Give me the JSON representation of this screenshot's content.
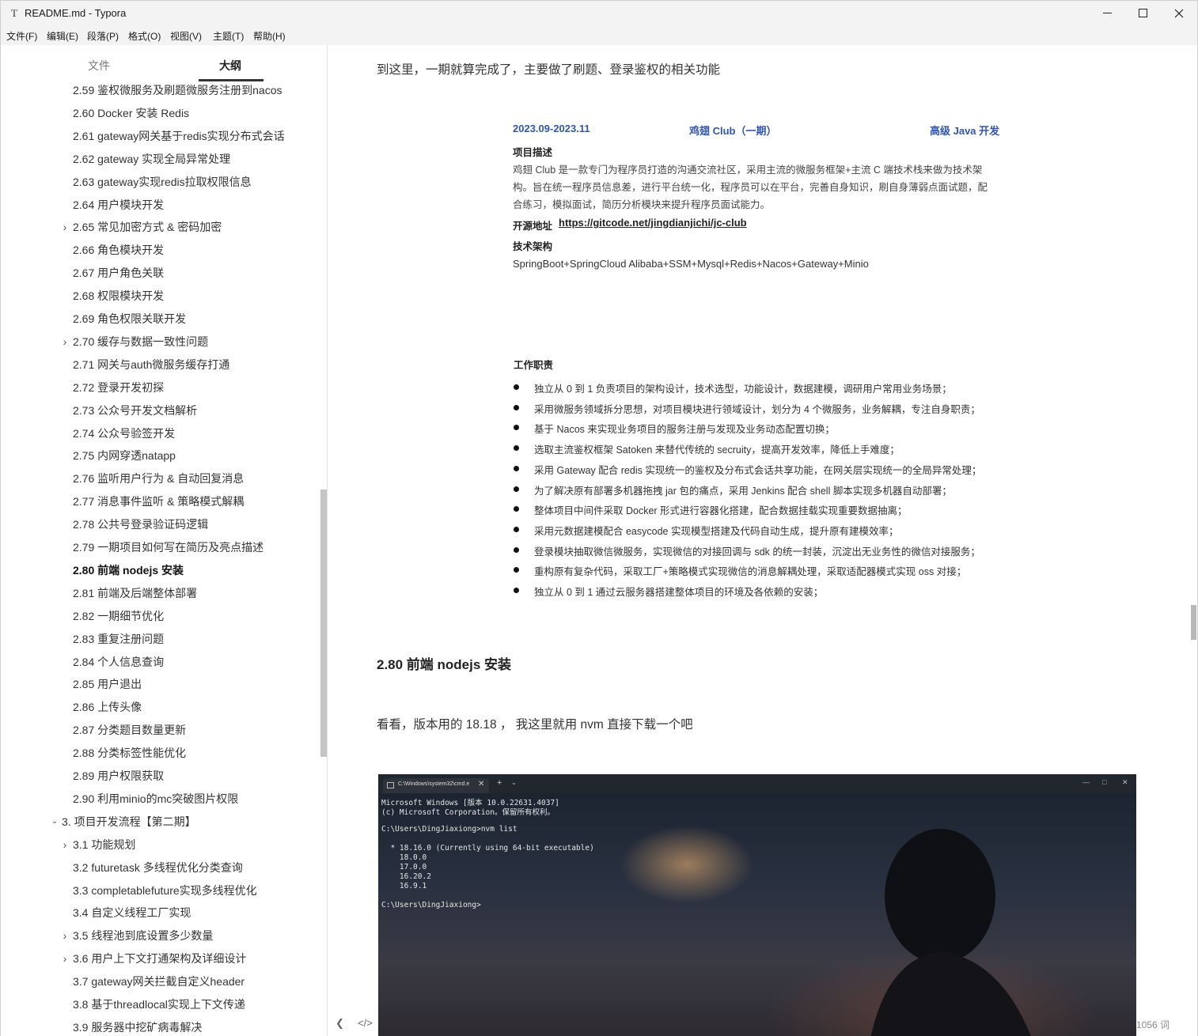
{
  "window": {
    "app_icon": "T",
    "title": "README.md - Typora",
    "controls": [
      "minimize-icon",
      "maximize-icon",
      "close-icon"
    ]
  },
  "menu": [
    "文件(F)",
    "编辑(E)",
    "段落(P)",
    "格式(O)",
    "视图(V)",
    "主题(T)",
    "帮助(H)"
  ],
  "sidebar": {
    "tabs": [
      "文件",
      "大纲"
    ],
    "active_tab": "大纲",
    "items": [
      {
        "label": "2.59 鉴权微服务及刷题微服务注册到nacos",
        "chevron": false,
        "active": false
      },
      {
        "label": "2.60 Docker 安装 Redis",
        "chevron": false,
        "active": false
      },
      {
        "label": "2.61 gateway网关基于redis实现分布式会话",
        "chevron": false,
        "active": false
      },
      {
        "label": "2.62 gateway 实现全局异常处理",
        "chevron": false,
        "active": false
      },
      {
        "label": "2.63 gateway实现redis拉取权限信息",
        "chevron": false,
        "active": false
      },
      {
        "label": "2.64 用户模块开发",
        "chevron": false,
        "active": false
      },
      {
        "label": "2.65 常见加密方式 & 密码加密",
        "chevron": true,
        "active": false
      },
      {
        "label": "2.66 角色模块开发",
        "chevron": false,
        "active": false
      },
      {
        "label": "2.67 用户角色关联",
        "chevron": false,
        "active": false
      },
      {
        "label": "2.68 权限模块开发",
        "chevron": false,
        "active": false
      },
      {
        "label": "2.69 角色权限关联开发",
        "chevron": false,
        "active": false
      },
      {
        "label": "2.70 缓存与数据一致性问题",
        "chevron": true,
        "active": false
      },
      {
        "label": "2.71 网关与auth微服务缓存打通",
        "chevron": false,
        "active": false
      },
      {
        "label": "2.72 登录开发初探",
        "chevron": false,
        "active": false
      },
      {
        "label": "2.73 公众号开发文档解析",
        "chevron": false,
        "active": false
      },
      {
        "label": "2.74 公众号验签开发",
        "chevron": false,
        "active": false
      },
      {
        "label": "2.75 内网穿透natapp",
        "chevron": false,
        "active": false
      },
      {
        "label": "2.76 监听用户行为 & 自动回复消息",
        "chevron": false,
        "active": false
      },
      {
        "label": "2.77 消息事件监听 & 策略模式解耦",
        "chevron": false,
        "active": false
      },
      {
        "label": "2.78 公共号登录验证码逻辑",
        "chevron": false,
        "active": false
      },
      {
        "label": "2.79 一期项目如何写在简历及亮点描述",
        "chevron": false,
        "active": false
      },
      {
        "label": "2.80 前端 nodejs 安装",
        "chevron": false,
        "active": true
      },
      {
        "label": "2.81 前端及后端整体部署",
        "chevron": false,
        "active": false
      },
      {
        "label": "2.82 一期细节优化",
        "chevron": false,
        "active": false
      },
      {
        "label": "2.83 重复注册问题",
        "chevron": false,
        "active": false
      },
      {
        "label": "2.84 个人信息查询",
        "chevron": false,
        "active": false
      },
      {
        "label": "2.85 用户退出",
        "chevron": false,
        "active": false
      },
      {
        "label": "2.86 上传头像",
        "chevron": false,
        "active": false
      },
      {
        "label": "2.87 分类题目数量更新",
        "chevron": false,
        "active": false
      },
      {
        "label": "2.88 分类标签性能优化",
        "chevron": false,
        "active": false
      },
      {
        "label": "2.89 用户权限获取",
        "chevron": false,
        "active": false
      },
      {
        "label": "2.90 利用minio的mc突破图片权限",
        "chevron": false,
        "active": false
      },
      {
        "label": "3. 项目开发流程【第二期】",
        "chevron": "down",
        "active": false,
        "level": 0
      },
      {
        "label": "3.1 功能规划",
        "chevron": true,
        "active": false
      },
      {
        "label": "3.2 futuretask 多线程优化分类查询",
        "chevron": false,
        "active": false
      },
      {
        "label": "3.3 completablefuture实现多线程优化",
        "chevron": false,
        "active": false
      },
      {
        "label": "3.4 自定义线程工厂实现",
        "chevron": false,
        "active": false
      },
      {
        "label": "3.5 线程池到底设置多少数量",
        "chevron": true,
        "active": false
      },
      {
        "label": "3.6 用户上下文打通架构及详细设计",
        "chevron": true,
        "active": false
      },
      {
        "label": "3.7 gateway网关拦截自定义header",
        "chevron": false,
        "active": false
      },
      {
        "label": "3.8 基于threadlocal实现上下文传递",
        "chevron": false,
        "active": false
      },
      {
        "label": "3.9 服务器中挖矿病毒解决",
        "chevron": false,
        "active": false
      }
    ]
  },
  "main": {
    "intro": "到这里，一期就算完成了，主要做了刷题、登录鉴权的相关功能",
    "resume": {
      "date": "2023.09-2023.11",
      "project": "鸡翅 Club（一期）",
      "role": "高级 Java 开发",
      "desc_title": "项目描述",
      "desc_lines": [
        "鸡翅 Club 是一款专门为程序员打造的沟通交流社区，采用主流的微服务框架+主流 C 端技术栈来做为技术架",
        "构。旨在统一程序员信息差，进行平台统一化，程序员可以在平台，完善自身知识，刷自身薄弱点面试题，配",
        "合练习，模拟面试，简历分析模块来提升程序员面试能力。"
      ],
      "repo_label": "开源地址",
      "repo_url": "https://gitcode.net/jingdianjichi/jc-club",
      "arch_title": "技术架构",
      "arch": "SpringBoot+SpringCloud Alibaba+SSM+Mysql+Redis+Nacos+Gateway+Minio",
      "duty_title": "工作职责",
      "duties": [
        "独立从 0 到 1 负责项目的架构设计，技术选型，功能设计，数据建模，调研用户常用业务场景；",
        "采用微服务领域拆分思想，对项目模块进行领域设计，划分为 4 个微服务，业务解耦，专注自身职责；",
        "基于 Nacos 来实现业务项目的服务注册与发现及业务动态配置切换；",
        "选取主流鉴权框架 Satoken 来替代传统的 secruity，提高开发效率，降低上手难度；",
        "采用 Gateway 配合 redis 实现统一的鉴权及分布式会话共享功能，在网关层实现统一的全局异常处理；",
        "为了解决原有部署多机器拖拽 jar 包的痛点，采用 Jenkins 配合 shell 脚本实现多机器自动部署；",
        "整体项目中间件采取 Docker 形式进行容器化搭建，配合数据挂载实现重要数据抽离；",
        "采用元数据建模配合 easycode 实现模型搭建及代码自动生成，提升原有建模效率；",
        "登录模块抽取微信微服务，实现微信的对接回调与 sdk 的统一封装，沉淀出无业务性的微信对接服务；",
        "重构原有复杂代码，采取工厂+策略模式实现微信的消息解耦处理，采取适配器模式实现 oss 对接；",
        "独立从 0 到 1 通过云服务器搭建整体项目的环境及各依赖的安装；"
      ]
    },
    "section_heading": "2.80 前端 nodejs 安装",
    "section_text": "看看，版本用的 18.18 ， 我这里就用 nvm 直接下载一个吧",
    "terminal": {
      "tab_title": "C:\\Windows\\system32\\cmd.e",
      "lines": [
        "Microsoft Windows [版本 10.0.22631.4037]",
        "(c) Microsoft Corporation。保留所有权利。",
        "",
        "C:\\Users\\DingJiaxiong>nvm list",
        "",
        "  * 18.16.0 (Currently using 64-bit executable)",
        "    18.0.0",
        "    17.0.0",
        "    16.20.2",
        "    16.9.1",
        "",
        "C:\\Users\\DingJiaxiong>"
      ]
    }
  },
  "statusbar": {
    "back_icon": "chevron-left-icon",
    "source_icon": "code-icon",
    "word_count": "1056 词"
  }
}
